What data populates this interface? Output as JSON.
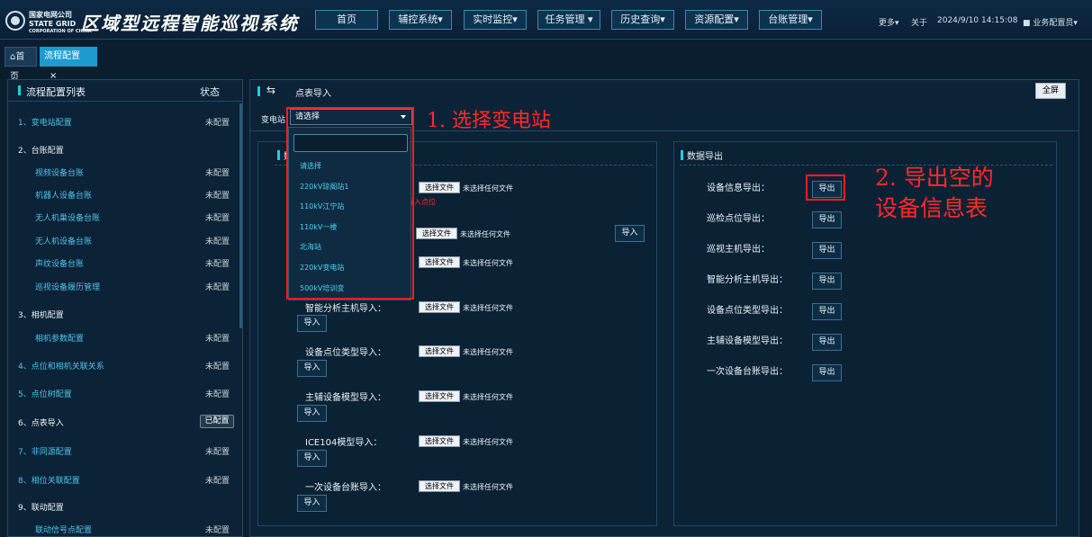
{
  "header": {
    "logo_line1": "国家电网公司",
    "logo_line2": "STATE GRID",
    "logo_line3": "CORPORATION OF CHINA",
    "title": "区域型远程智能巡视系统",
    "nav": [
      "首页",
      "辅控系统▾",
      "实时监控▾",
      "任务管理 ▾",
      "历史查询▾",
      "资源配置▾",
      "台账管理▾"
    ],
    "more": "更多▾",
    "about": "关于",
    "datetime": "2024/9/10 14:15:08",
    "user": "业务配置员▾"
  },
  "tabs": {
    "home": "首页",
    "active": "流程配置",
    "close": "×"
  },
  "left": {
    "title": "流程配置列表",
    "status_header": "状态",
    "rows": [
      {
        "label": "1、变电站配置",
        "status": "未配置",
        "indent": false,
        "link": true
      },
      {
        "label": "2、台账配置",
        "status": "",
        "indent": false,
        "link": false
      },
      {
        "label": "视频设备台账",
        "status": "未配置",
        "indent": true,
        "link": true
      },
      {
        "label": "机器人设备台账",
        "status": "未配置",
        "indent": true,
        "link": true
      },
      {
        "label": "无人机巢设备台账",
        "status": "未配置",
        "indent": true,
        "link": true
      },
      {
        "label": "无人机设备台账",
        "status": "未配置",
        "indent": true,
        "link": true
      },
      {
        "label": "声纹设备台账",
        "status": "未配置",
        "indent": true,
        "link": true
      },
      {
        "label": "巡视设备履历管理",
        "status": "未配置",
        "indent": true,
        "link": true
      },
      {
        "label": "3、相机配置",
        "status": "",
        "indent": false,
        "link": false
      },
      {
        "label": "相机参数配置",
        "status": "未配置",
        "indent": true,
        "link": true
      },
      {
        "label": "4、点位和相机关联关系",
        "status": "未配置",
        "indent": false,
        "link": true
      },
      {
        "label": "5、点位树配置",
        "status": "未配置",
        "indent": false,
        "link": true
      },
      {
        "label": "6、点表导入",
        "status": "已配置",
        "indent": false,
        "link": false
      },
      {
        "label": "7、非同源配置",
        "status": "未配置",
        "indent": false,
        "link": true
      },
      {
        "label": "8、相位关联配置",
        "status": "未配置",
        "indent": false,
        "link": true
      },
      {
        "label": "9、联动配置",
        "status": "",
        "indent": false,
        "link": false
      },
      {
        "label": "联动信号点配置",
        "status": "未配置",
        "indent": true,
        "link": true
      }
    ]
  },
  "right": {
    "title": "点表导入",
    "fullscreen": "全屏",
    "station_label": "变电站",
    "station_value": "请选择",
    "import_section_title": "数",
    "export_section_title": "数据导出",
    "choose_file": "选择文件",
    "no_file": "未选择任何文件",
    "import_btn": "导入",
    "export_btn": "导出",
    "red_note": "导入点位",
    "import_rows": [
      "智能分析主机导入：",
      "设备点位类型导入：",
      "主辅设备模型导入：",
      "ICE104模型导入：",
      "一次设备台账导入："
    ],
    "export_rows": [
      "设备信息导出：",
      "巡检点位导出：",
      "巡视主机导出：",
      "智能分析主机导出：",
      "设备点位类型导出：",
      "主辅设备模型导出：",
      "一次设备台账导出："
    ]
  },
  "dropdown": {
    "options": [
      "请选择",
      "220kV琼阁站1",
      "110kV江宁站",
      "110kV一楼",
      "北海站",
      "220kV变电站",
      "500kV培训变"
    ]
  },
  "annotations": {
    "step1": "1. 选择变电站",
    "step2_line1": "2. 导出空的",
    "step2_line2": "设备信息表"
  }
}
